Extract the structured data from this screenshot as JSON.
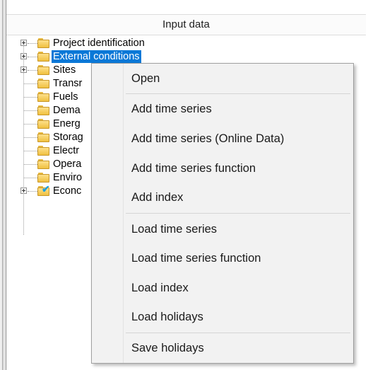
{
  "header": {
    "title": "Input data"
  },
  "tree": {
    "items": [
      {
        "label": "Project identification",
        "expandable": true,
        "icon": "folder-icon"
      },
      {
        "label": "External conditions",
        "expandable": true,
        "selected": true,
        "icon": "folder-icon"
      },
      {
        "label": "Sites",
        "expandable": true,
        "icon": "folder-icon"
      },
      {
        "label": "Transr",
        "expandable": false,
        "icon": "folder-icon"
      },
      {
        "label": "Fuels",
        "expandable": false,
        "icon": "folder-icon"
      },
      {
        "label": "Dema",
        "expandable": false,
        "icon": "folder-icon"
      },
      {
        "label": "Energ",
        "expandable": false,
        "icon": "folder-icon"
      },
      {
        "label": "Storag",
        "expandable": false,
        "icon": "folder-icon"
      },
      {
        "label": "Electr",
        "expandable": false,
        "icon": "folder-icon"
      },
      {
        "label": "Opera",
        "expandable": false,
        "icon": "folder-icon"
      },
      {
        "label": "Enviro",
        "expandable": false,
        "icon": "folder-icon"
      },
      {
        "label": "Econc",
        "expandable": true,
        "icon": "checked-folder-icon"
      }
    ]
  },
  "context_menu": {
    "items": [
      {
        "label": "Open"
      },
      {
        "label": "Add time series"
      },
      {
        "label": "Add time series (Online Data)"
      },
      {
        "label": "Add time series function"
      },
      {
        "label": "Add index"
      },
      {
        "label": "Load time series"
      },
      {
        "label": "Load time series function"
      },
      {
        "label": "Load index"
      },
      {
        "label": "Load holidays"
      },
      {
        "label": "Save holidays"
      }
    ]
  },
  "colors": {
    "selection": "#0a78d7",
    "folder": "#f0c040",
    "check": "#1f9fdc",
    "menu_background": "#f2f2f2"
  }
}
